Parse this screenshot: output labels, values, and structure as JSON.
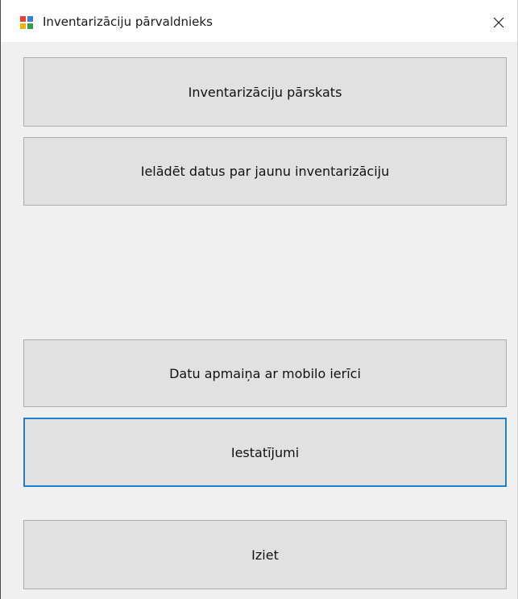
{
  "window": {
    "title": "Inventarizāciju pārvaldnieks",
    "app_icon": "windows-app-icon",
    "close_icon": "close-icon"
  },
  "buttons": {
    "overview": "Inventarizāciju pārskats",
    "load_data": "Ielādēt datus par jaunu inventarizāciju",
    "exchange": "Datu apmaiņa ar mobilo ierīci",
    "settings": "Iestatījumi",
    "exit": "Iziet"
  },
  "colors": {
    "background": "#f0f0f0",
    "button": "#e1e1e1",
    "button_border": "#adadad",
    "focus_border": "#1c7fd6"
  }
}
